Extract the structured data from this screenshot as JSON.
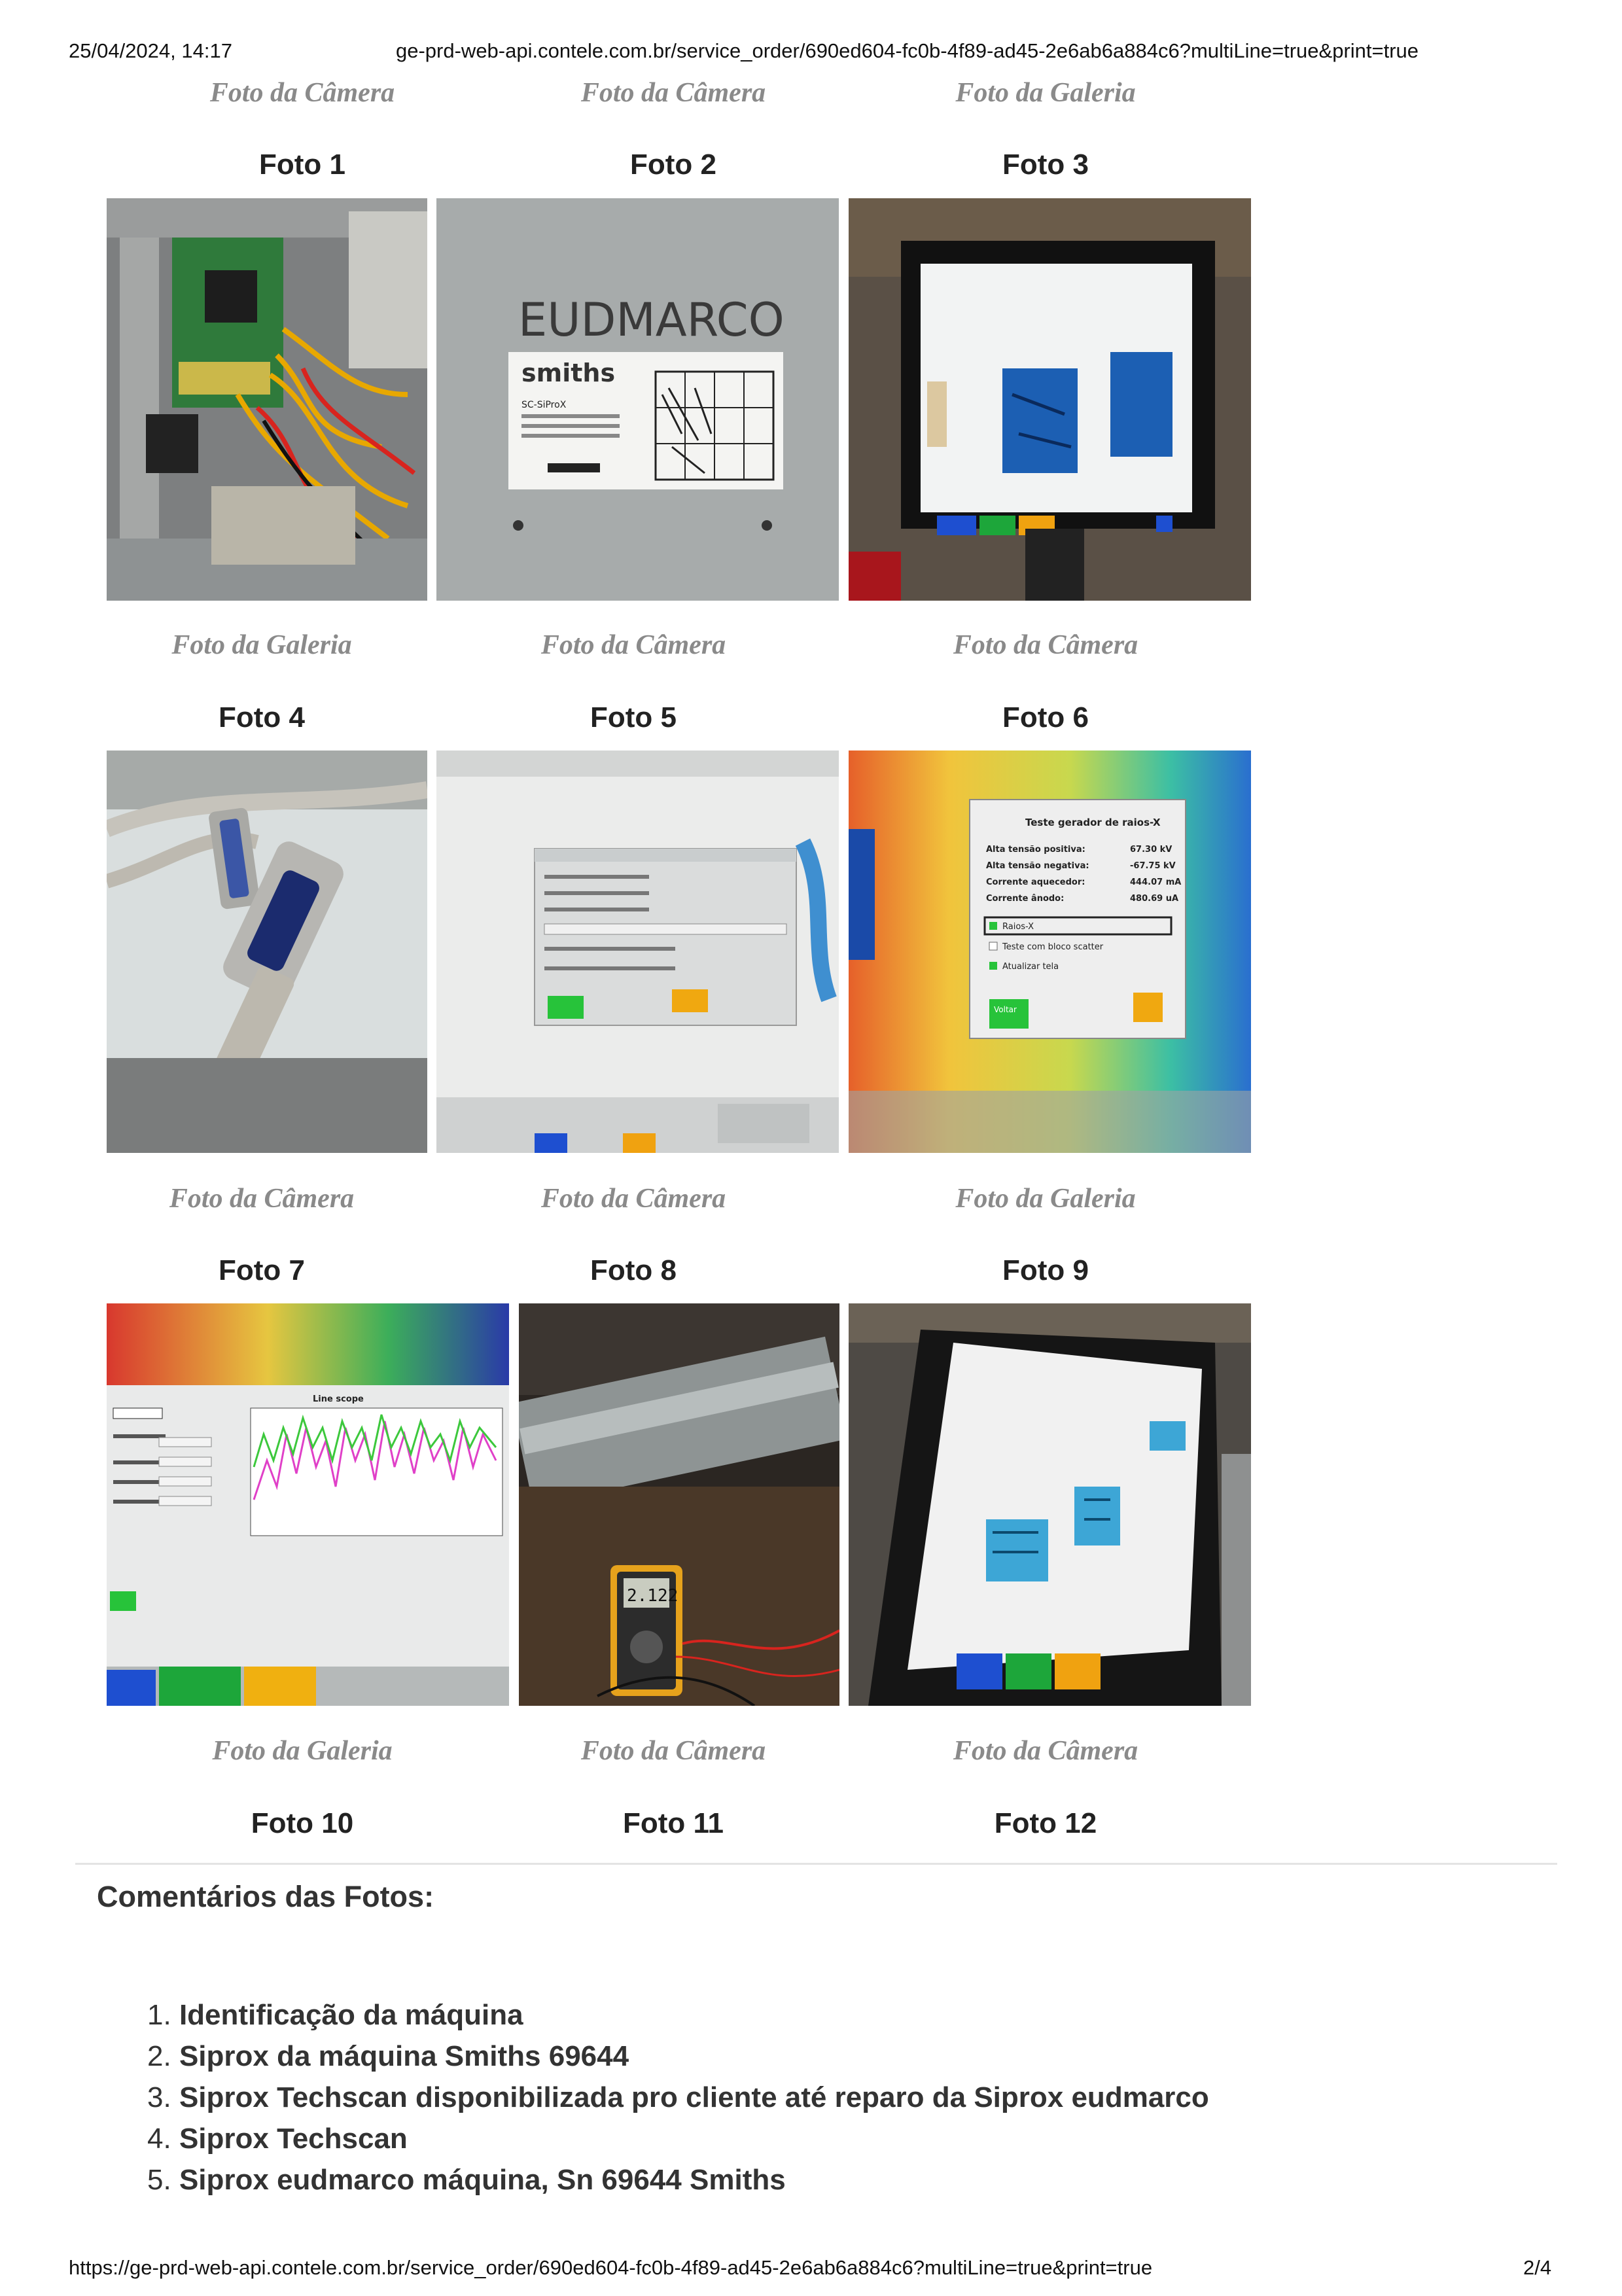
{
  "header": {
    "datetime": "25/04/2024, 14:17",
    "url": "ge-prd-web-api.contele.com.br/service_order/690ed604-fc0b-4f89-ad45-2e6ab6a884c6?multiLine=true&print=true"
  },
  "photos": [
    {
      "source": "Foto da Câmera",
      "label": "Foto 1"
    },
    {
      "source": "Foto da Câmera",
      "label": "Foto 2"
    },
    {
      "source": "Foto da Galeria",
      "label": "Foto 3"
    },
    {
      "source": "Foto da Galeria",
      "label": "Foto 4"
    },
    {
      "source": "Foto da Câmera",
      "label": "Foto 5"
    },
    {
      "source": "Foto da Câmera",
      "label": "Foto 6"
    },
    {
      "source": "Foto da Câmera",
      "label": "Foto 7"
    },
    {
      "source": "Foto da Câmera",
      "label": "Foto 8"
    },
    {
      "source": "Foto da Galeria",
      "label": "Foto 9"
    },
    {
      "source": "Foto da Galeria",
      "label": "Foto 10"
    },
    {
      "source": "Foto da Câmera",
      "label": "Foto 11"
    },
    {
      "source": "Foto da Câmera",
      "label": "Foto 12"
    }
  ],
  "photo_text": {
    "p2_handwriting": "EUDMARCO",
    "p2_brand": "smiths",
    "p2_type": "SC-SiProX",
    "p6_title": "Teste gerador de raios-X",
    "p6_rows": [
      {
        "label": "Alta tensão positiva:",
        "value": "67.30 kV"
      },
      {
        "label": "Alta tensão negativa:",
        "value": "-67.75 kV"
      },
      {
        "label": "Corrente aquecedor:",
        "value": "444.07 mA"
      },
      {
        "label": "Corrente ânodo:",
        "value": "480.69 uA"
      }
    ],
    "p6_check1": "Raios-X",
    "p6_check2": "Teste com bloco scatter",
    "p6_check3": "Atualizar tela",
    "p6_button": "Voltar",
    "p7_title": "Line scope",
    "p8_meter": "2.122"
  },
  "comments": {
    "title": "Comentários das Fotos:",
    "items": [
      {
        "num": "1.",
        "text": "Identificação da máquina"
      },
      {
        "num": "2.",
        "text": "Siprox da máquina Smiths 69644"
      },
      {
        "num": "3.",
        "text": "Siprox Techscan disponibilizada pro cliente até reparo da Siprox eudmarco"
      },
      {
        "num": "4.",
        "text": "Siprox Techscan"
      },
      {
        "num": "5.",
        "text": "Siprox eudmarco máquina, Sn 69644 Smiths"
      }
    ]
  },
  "footer": {
    "url": "https://ge-prd-web-api.contele.com.br/service_order/690ed604-fc0b-4f89-ad45-2e6ab6a884c6?multiLine=true&print=true",
    "page": "2/4"
  }
}
